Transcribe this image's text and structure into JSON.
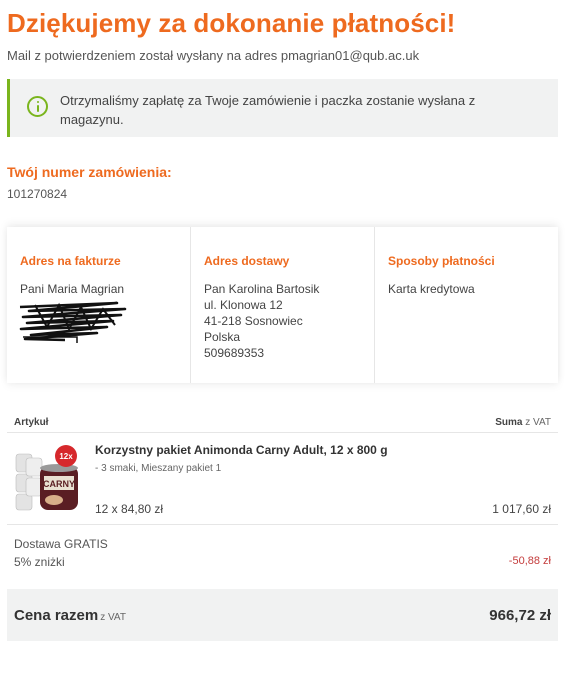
{
  "header": {
    "title": "Dziękujemy za dokonanie płatności!",
    "mail_info": "Mail z potwierdzeniem został wysłany na adres pmagrian01@qub.ac.uk"
  },
  "notice": {
    "text": "Otrzymaliśmy zapłatę za Twoje zamówienie i paczka zostanie wysłana z magazynu.",
    "icon": "info-icon",
    "accent_color": "#7ab51d"
  },
  "order": {
    "label": "Twój numer zamówienia:",
    "number": "101270824"
  },
  "billing": {
    "title": "Adres na fakturze",
    "name": "Pani Maria Magrian"
  },
  "shipping": {
    "title": "Adres dostawy",
    "name": "Pan Karolina Bartosik",
    "street": "ul. Klonowa 12",
    "city": "41-218 Sosnowiec",
    "country": "Polska",
    "phone": "509689353"
  },
  "payment": {
    "title": "Sposoby płatności",
    "method": "Karta kredytowa"
  },
  "table": {
    "col_article": "Artykuł",
    "col_sum": "Suma",
    "col_sum_vat": "z VAT"
  },
  "product": {
    "name": "Korzystny pakiet Animonda Carny Adult, 12 x 800 g",
    "variant": "- 3 smaki, Mieszany pakiet 1",
    "qty_price": "12 x 84,80 zł",
    "total": "1 017,60 zł",
    "badge": "12x",
    "brand": "CARNY"
  },
  "extras": {
    "shipping": "Dostawa GRATIS",
    "discount_label": "5% zniżki",
    "discount_value": "-50,88 zł"
  },
  "total": {
    "label": "Cena razem",
    "vat": "z VAT",
    "value": "966,72 zł"
  },
  "colors": {
    "accent": "#ee6a1f",
    "success": "#7ab51d",
    "negative": "#c43c3c"
  }
}
